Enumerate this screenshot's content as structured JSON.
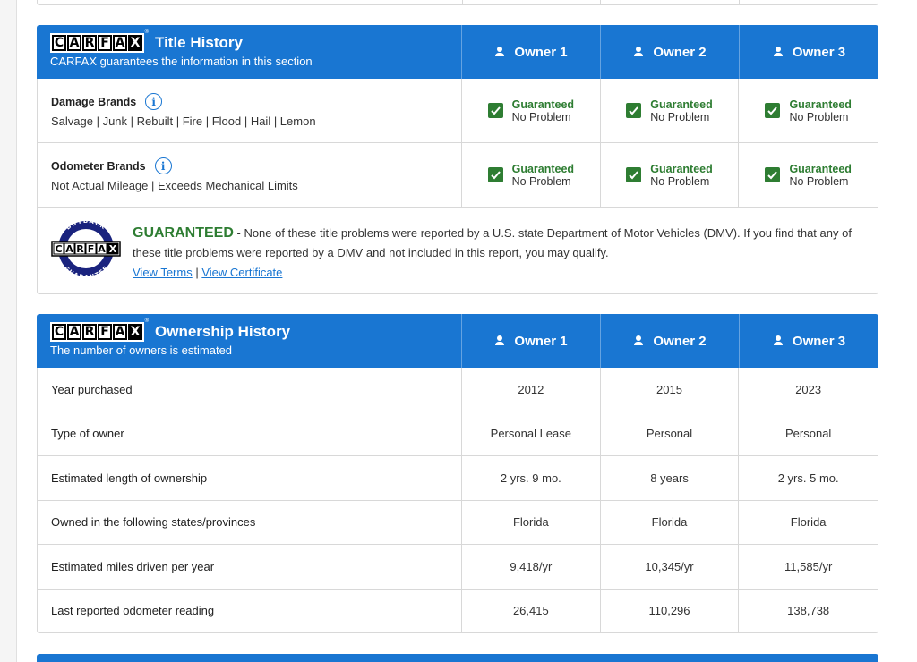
{
  "title_history": {
    "logo_letters": [
      "C",
      "A",
      "R",
      "F",
      "A",
      "X"
    ],
    "title": "Title History",
    "subtitle": "CARFAX guarantees the information in this section",
    "owners": [
      "Owner 1",
      "Owner 2",
      "Owner 3"
    ],
    "rows": [
      {
        "label": "Damage Brands",
        "sub": "Salvage | Junk | Rebuilt | Fire | Flood | Hail | Lemon",
        "cells": [
          {
            "status": "Guaranteed",
            "text": "No Problem"
          },
          {
            "status": "Guaranteed",
            "text": "No Problem"
          },
          {
            "status": "Guaranteed",
            "text": "No Problem"
          }
        ]
      },
      {
        "label": "Odometer Brands",
        "sub": "Not Actual Mileage | Exceeds Mechanical Limits",
        "cells": [
          {
            "status": "Guaranteed",
            "text": "No Problem"
          },
          {
            "status": "Guaranteed",
            "text": "No Problem"
          },
          {
            "status": "Guaranteed",
            "text": "No Problem"
          }
        ]
      }
    ],
    "guarantee": {
      "badge_top": "BUYBACK",
      "badge_bottom": "GUARANTEE",
      "heading": "GUARANTEED",
      "body": " - None of these title problems were reported by a U.S. state Department of Motor Vehicles (DMV). If you find that any of these title problems were reported by a DMV and not included in this report, you may qualify.",
      "view_terms": "View Terms",
      "separator": " | ",
      "view_certificate": "View Certificate"
    }
  },
  "ownership_history": {
    "logo_letters": [
      "C",
      "A",
      "R",
      "F",
      "A",
      "X"
    ],
    "title": "Ownership History",
    "subtitle": "The number of owners is estimated",
    "owners": [
      "Owner 1",
      "Owner 2",
      "Owner 3"
    ],
    "rows": [
      {
        "label": "Year purchased",
        "values": [
          "2012",
          "2015",
          "2023"
        ]
      },
      {
        "label": "Type of owner",
        "values": [
          "Personal Lease",
          "Personal",
          "Personal"
        ]
      },
      {
        "label": "Estimated length of ownership",
        "values": [
          "2 yrs. 9 mo.",
          "8 years",
          "2 yrs. 5 mo."
        ]
      },
      {
        "label": "Owned in the following states/provinces",
        "values": [
          "Florida",
          "Florida",
          "Florida"
        ]
      },
      {
        "label": "Estimated miles driven per year",
        "values": [
          "9,418/yr",
          "10,345/yr",
          "11,585/yr"
        ]
      },
      {
        "label": "Last reported odometer reading",
        "values": [
          "26,415",
          "110,296",
          "138,738"
        ]
      }
    ]
  },
  "colors": {
    "header_blue": "#1976d2",
    "guaranteed_green": "#2e7d32",
    "link_blue": "#1976d2"
  }
}
